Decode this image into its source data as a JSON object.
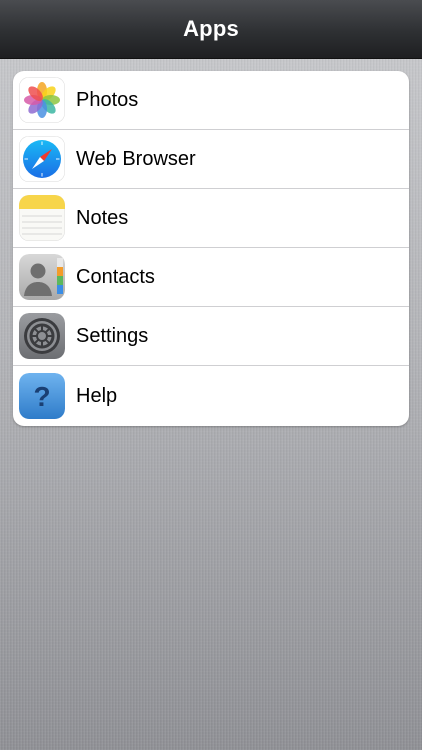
{
  "navbar": {
    "title": "Apps"
  },
  "apps": [
    {
      "label": "Photos",
      "icon": "photos-icon"
    },
    {
      "label": "Web Browser",
      "icon": "compass-icon"
    },
    {
      "label": "Notes",
      "icon": "notepad-icon"
    },
    {
      "label": "Contacts",
      "icon": "contacts-icon"
    },
    {
      "label": "Settings",
      "icon": "gear-icon"
    },
    {
      "label": "Help",
      "icon": "question-mark-icon"
    }
  ],
  "colors": {
    "navbar": "#2e3033",
    "list_background": "#ffffff",
    "separator": "#cfcfd2",
    "help_blue": "#2f7cc9",
    "notes_yellow": "#f7d54a",
    "browser_blue": "#1c8ef0"
  }
}
